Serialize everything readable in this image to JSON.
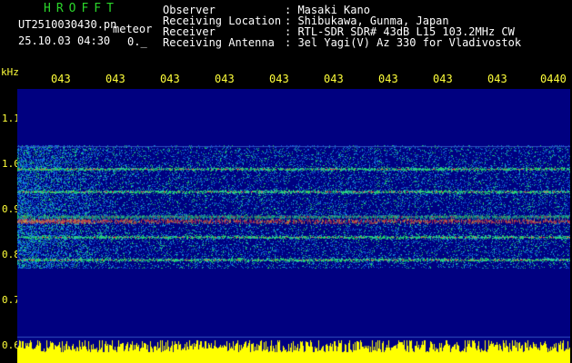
{
  "header": {
    "app_title": "HROFFT",
    "filename": "UT2510030430.pn",
    "file_type": "meteor",
    "datetime": "25.10.03 04:30",
    "counter": "0._",
    "info": [
      {
        "label": "Observer",
        "value": ": Masaki Kano"
      },
      {
        "label": "Receiving Location",
        "value": ": Shibukawa, Gunma, Japan"
      },
      {
        "label": "Receiver",
        "value": ": RTL-SDR SDR# 43dB L15 103.2MHz CW"
      },
      {
        "label": "Receiving Antenna",
        "value": ": 3el Yagi(V) Az 330 for Vladivostok"
      }
    ]
  },
  "axis": {
    "unit": "kHz",
    "y_ticks": [
      "1.1",
      "1.0",
      "0.9",
      "0.8",
      "0.7",
      "0.6"
    ],
    "time_labels": [
      "043",
      "043",
      "043",
      "043",
      "043",
      "043",
      "043",
      "043",
      "043",
      "0440"
    ]
  },
  "colors": {
    "background": "#000000",
    "plot_background": "#000080",
    "signal_line": "#ff3030",
    "noise_green": "#20d060",
    "baseline": "#ffff00",
    "text_yellow": "#ffff3a",
    "title_green": "#2bd62b"
  },
  "spectrogram": {
    "band_top_khz": 1.04,
    "band_bottom_khz": 0.77,
    "signal_lines_khz": [
      0.99,
      0.94,
      0.885,
      0.84,
      0.79
    ],
    "strong_line_khz": 0.875
  }
}
